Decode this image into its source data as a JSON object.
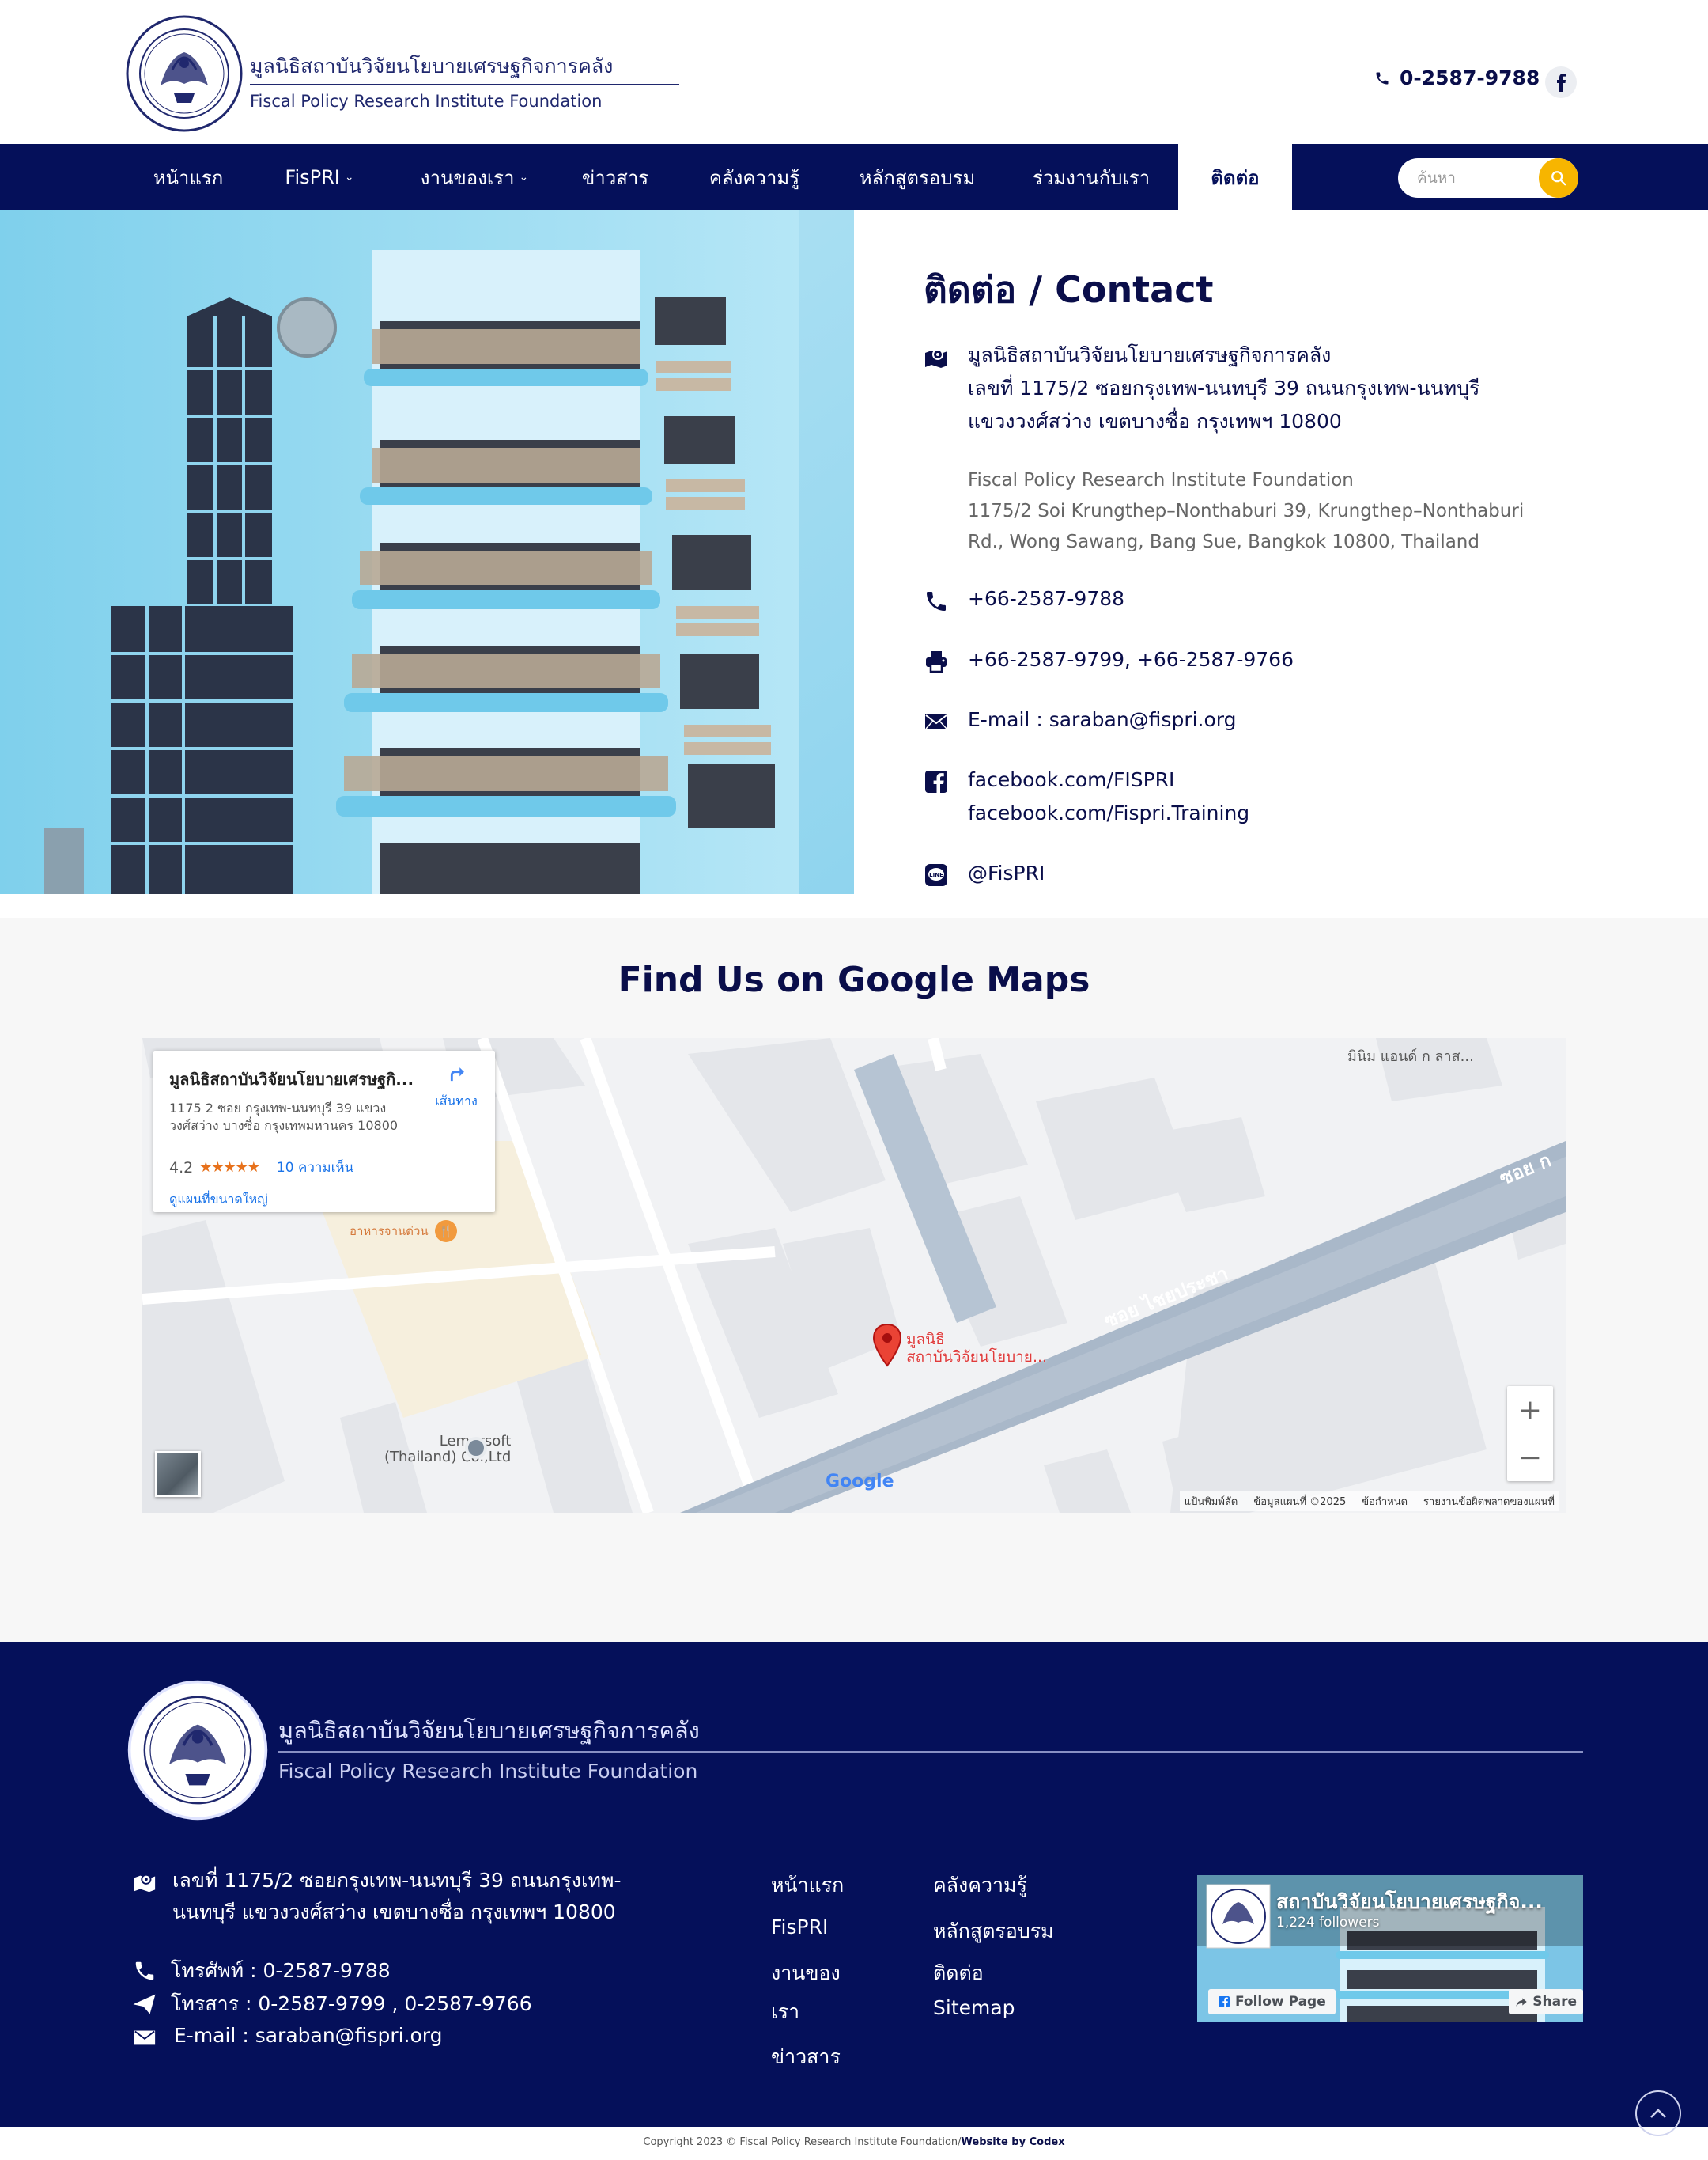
{
  "header": {
    "logo_th": "มูลนิธิสถาบันวิจัยนโยบายเศรษฐกิจการคลัง",
    "logo_en": "Fiscal Policy Research Institute Foundation",
    "phone": "0-2587-9788"
  },
  "nav": {
    "items": [
      {
        "label": "หน้าแรก"
      },
      {
        "label": "FisPRI"
      },
      {
        "label": "งานของเรา"
      },
      {
        "label": "ข่าวสาร"
      },
      {
        "label": "คลังความรู้"
      },
      {
        "label": "หลักสูตรอบรม"
      },
      {
        "label": "ร่วมงานกับเรา"
      },
      {
        "label": "ติดต่อ"
      }
    ],
    "search_placeholder": "ค้นหา"
  },
  "contact": {
    "title": "ติดต่อ / Contact",
    "address_th": [
      "มูลนิธิสถาบันวิจัยนโยบายเศรษฐกิจการคลัง",
      "เลขที่ 1175/2 ซอยกรุงเทพ-นนทบุรี 39 ถนนกรุงเทพ-นนทบุรี",
      "แขวงวงศ์สว่าง เขตบางซื่อ กรุงเทพฯ 10800"
    ],
    "address_en": [
      "Fiscal Policy Research Institute Foundation",
      "1175/2 Soi Krungthep–Nonthaburi 39, Krungthep–Nonthaburi",
      "Rd., Wong Sawang, Bang Sue, Bangkok 10800, Thailand"
    ],
    "phone": "+66-2587-9788",
    "fax": "+66-2587-9799, +66-2587-9766",
    "email": "E-mail : saraban@fispri.org",
    "facebook": [
      "facebook.com/FISPRI",
      "facebook.com/Fispri.Training"
    ],
    "line": "@FisPRI"
  },
  "map": {
    "title": "Find Us on Google Maps",
    "card": {
      "name": "มูลนิธิสถาบันวิจัยนโยบายเศรษฐกิ...",
      "address": "1175 2 ซอย กรุงเทพ-นนทบุรี 39 แขวง วงศ์สว่าง บางซื่อ กรุงเทพมหานคร 10800",
      "rating": "4.2",
      "stars": "★★★★★",
      "reviews": "10 ความเห็น",
      "larger_map": "ดูแผนที่ขนาดใหญ่",
      "directions": "เส้นทาง"
    },
    "labels": {
      "top_right": "มินิม แอนด์ ก ลาส...",
      "fastfood": "อาหารจานด่วน",
      "marker_line1": "มูลนิธิ",
      "marker_line2": "สถาบันวิจัยนโยบาย...",
      "street1": "ซอย ไชยประชา",
      "street2": "ซอย ก",
      "lemurs1": "Lemursoft",
      "lemurs2": "(Thailand) Co.,Ltd",
      "google": "Google"
    },
    "footer": [
      "แป้นพิมพ์ลัด",
      "ข้อมูลแผนที่ ©2025",
      "ข้อกำหนด",
      "รายงานข้อผิดพลาดของแผนที่"
    ]
  },
  "footer": {
    "logo_th": "มูลนิธิสถาบันวิจัยนโยบายเศรษฐกิจการคลัง",
    "logo_en": "Fiscal Policy Research Institute Foundation",
    "address": [
      "เลขที่ 1175/2 ซอยกรุงเทพ-นนทบุรี 39 ถนนกรุงเทพ-",
      "นนทบุรี แขวงวงศ์สว่าง เขตบางซื่อ กรุงเทพฯ 10800"
    ],
    "phone": "โทรศัพท์ : 0-2587-9788",
    "fax": "โทรสาร : 0-2587-9799 , 0-2587-9766",
    "email": "E-mail : saraban@fispri.org",
    "links_col1": [
      "หน้าแรก",
      "FisPRI",
      "งานของ",
      "เรา",
      "ข่าวสาร"
    ],
    "links_col2": [
      "คลังความรู้",
      "หลักสูตรอบรม",
      "ติดต่อ",
      "Sitemap"
    ],
    "fb_widget": {
      "title": "สถาบันวิจัยนโยบายเศรษฐกิจ...",
      "followers": "1,224 followers",
      "follow": "Follow Page",
      "share": "Share"
    }
  },
  "copyright": {
    "text": "Copyright 2023 © Fiscal Policy Research Institute Foundation/",
    "credit": "Website by Codex"
  }
}
